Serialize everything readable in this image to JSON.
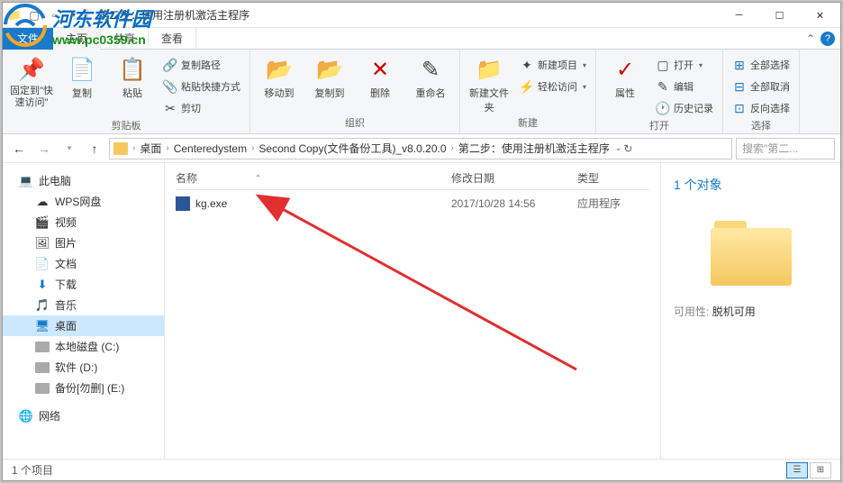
{
  "titlebar": {
    "title": "第二步：使用注册机激活主程序"
  },
  "tabs": {
    "file": "文件",
    "home": "主页",
    "share": "共享",
    "view": "查看"
  },
  "ribbon": {
    "pin": "固定到\"快速访问\"",
    "copy": "复制",
    "paste": "粘贴",
    "copyPath": "复制路径",
    "pasteShortcut": "粘贴快捷方式",
    "cut": "剪切",
    "clipboardGroup": "剪贴板",
    "moveTo": "移动到",
    "copyTo": "复制到",
    "delete": "删除",
    "rename": "重命名",
    "orgGroup": "组织",
    "newFolder": "新建文件夹",
    "newItem": "新建项目",
    "easyAccess": "轻松访问",
    "newGroup": "新建",
    "properties": "属性",
    "open": "打开",
    "edit": "编辑",
    "history": "历史记录",
    "openGroup": "打开",
    "selectAll": "全部选择",
    "selectNone": "全部取消",
    "invertSel": "反向选择",
    "selectGroup": "选择"
  },
  "breadcrumb": {
    "b0": "桌面",
    "b1": "Centeredystem",
    "b2": "Second Copy(文件备份工具)_v8.0.20.0",
    "b3": "第二步：使用注册机激活主程序"
  },
  "search": {
    "placeholder": "搜索\"第二..."
  },
  "sidebar": {
    "thisPC": "此电脑",
    "wps": "WPS网盘",
    "video": "视频",
    "pictures": "图片",
    "documents": "文档",
    "downloads": "下载",
    "music": "音乐",
    "desktop": "桌面",
    "localC": "本地磁盘 (C:)",
    "softD": "软件 (D:)",
    "backupE": "备份[勿删] (E:)",
    "network": "网络"
  },
  "filelist": {
    "colName": "名称",
    "colDate": "修改日期",
    "colType": "类型",
    "row0": {
      "name": "kg.exe",
      "date": "2017/10/28 14:56",
      "type": "应用程序"
    }
  },
  "preview": {
    "count": "1 个对象",
    "availLabel": "可用性:",
    "availValue": "脱机可用"
  },
  "statusbar": {
    "text": "1 个项目"
  },
  "watermark": {
    "name": "河东软件园",
    "url": "www.pc0359.cn"
  }
}
